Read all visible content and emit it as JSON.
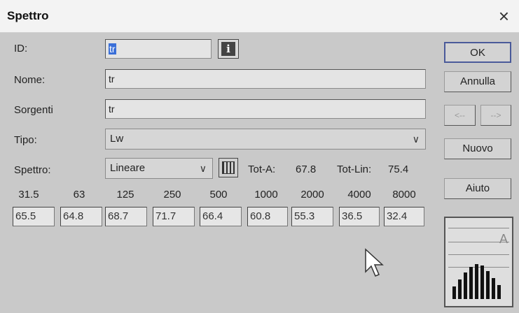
{
  "window": {
    "title": "Spettro",
    "close_glyph": "×"
  },
  "fields": {
    "id": {
      "label": "ID:",
      "value": "tr"
    },
    "nome": {
      "label": "Nome:",
      "value": "tr"
    },
    "sorgenti": {
      "label": "Sorgenti",
      "value": "tr"
    },
    "tipo": {
      "label": "Tipo:",
      "value": "Lw"
    },
    "spettro": {
      "label": "Spettro:",
      "value": "Lineare"
    }
  },
  "totals": {
    "tot_a_label": "Tot-A:",
    "tot_a_value": "67.8",
    "tot_lin_label": "Tot-Lin:",
    "tot_lin_value": "75.4"
  },
  "frequencies": [
    "31.5",
    "63",
    "125",
    "250",
    "500",
    "1000",
    "2000",
    "4000",
    "8000"
  ],
  "values": [
    "65.5",
    "64.8",
    "68.7",
    "71.7",
    "66.4",
    "60.8",
    "55.3",
    "36.5",
    "32.4"
  ],
  "buttons": {
    "ok": "OK",
    "annulla": "Annulla",
    "prev": "<--",
    "next": "-->",
    "nuovo": "Nuovo",
    "aiuto": "Aiuto"
  },
  "mini_chart": {
    "label": "A",
    "levels": [
      0.35,
      0.55,
      0.75,
      0.92,
      1.0,
      0.95,
      0.8,
      0.6,
      0.4
    ]
  },
  "icons": {
    "info": "info-icon",
    "calculator": "calculator-icon",
    "dropdown": "chevron-down-icon"
  }
}
